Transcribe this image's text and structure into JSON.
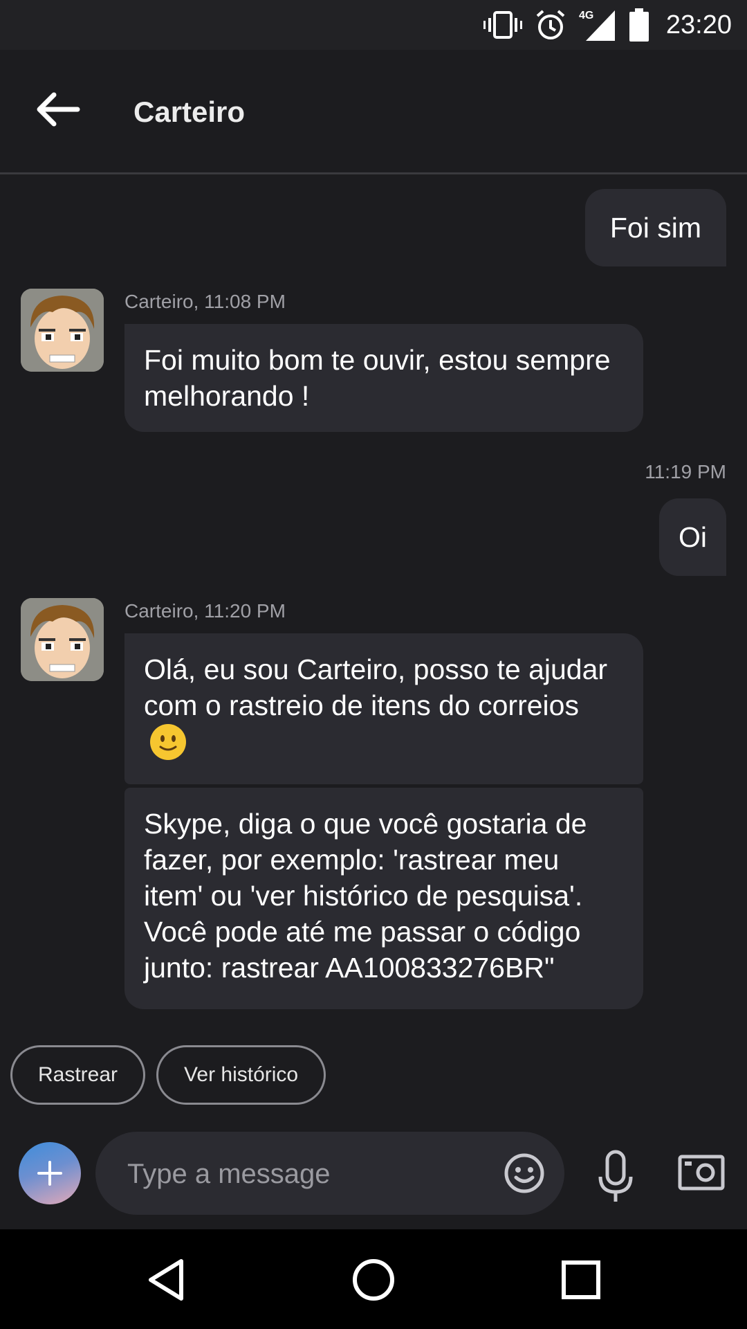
{
  "status_bar": {
    "time": "23:20",
    "network": "4G",
    "icons": [
      "vibrate-icon",
      "alarm-icon",
      "signal-icon",
      "battery-icon"
    ]
  },
  "header": {
    "title": "Carteiro",
    "back_icon": "arrow-left-icon"
  },
  "messages": [
    {
      "direction": "out",
      "text": "Foi sim"
    },
    {
      "direction": "in",
      "meta": "Carteiro, 11:08 PM",
      "text": "Foi muito bom te ouvir, estou sempre melhorando !"
    },
    {
      "direction": "out",
      "meta": "11:19 PM",
      "text": "Oi"
    },
    {
      "direction": "in",
      "meta": "Carteiro, 11:20 PM",
      "text": "Olá, eu sou Carteiro, posso te ajudar com o rastreio de itens do correios",
      "emoji": "slightly-smiling-face"
    },
    {
      "direction": "in",
      "text": "Skype, diga o que você gostaria de fazer, por exemplo: 'rastrear meu item' ou 'ver histórico de pesquisa'. Você pode até me passar o código junto: rastrear AA100833276BR\""
    }
  ],
  "suggested_actions": [
    {
      "label": "Rastrear"
    },
    {
      "label": "Ver histórico"
    }
  ],
  "composer": {
    "placeholder": "Type a message",
    "value": "",
    "icons": [
      "plus-icon",
      "emoji-icon",
      "microphone-icon",
      "camera-icon"
    ]
  },
  "nav_bar": {
    "icons": [
      "back-triangle-icon",
      "home-circle-icon",
      "recents-square-icon"
    ]
  },
  "colors": {
    "background": "#1c1c1f",
    "bubble": "#2b2b31",
    "status_bar": "#222225",
    "nav_bar": "#000000",
    "meta_text": "#a0a0a6"
  }
}
